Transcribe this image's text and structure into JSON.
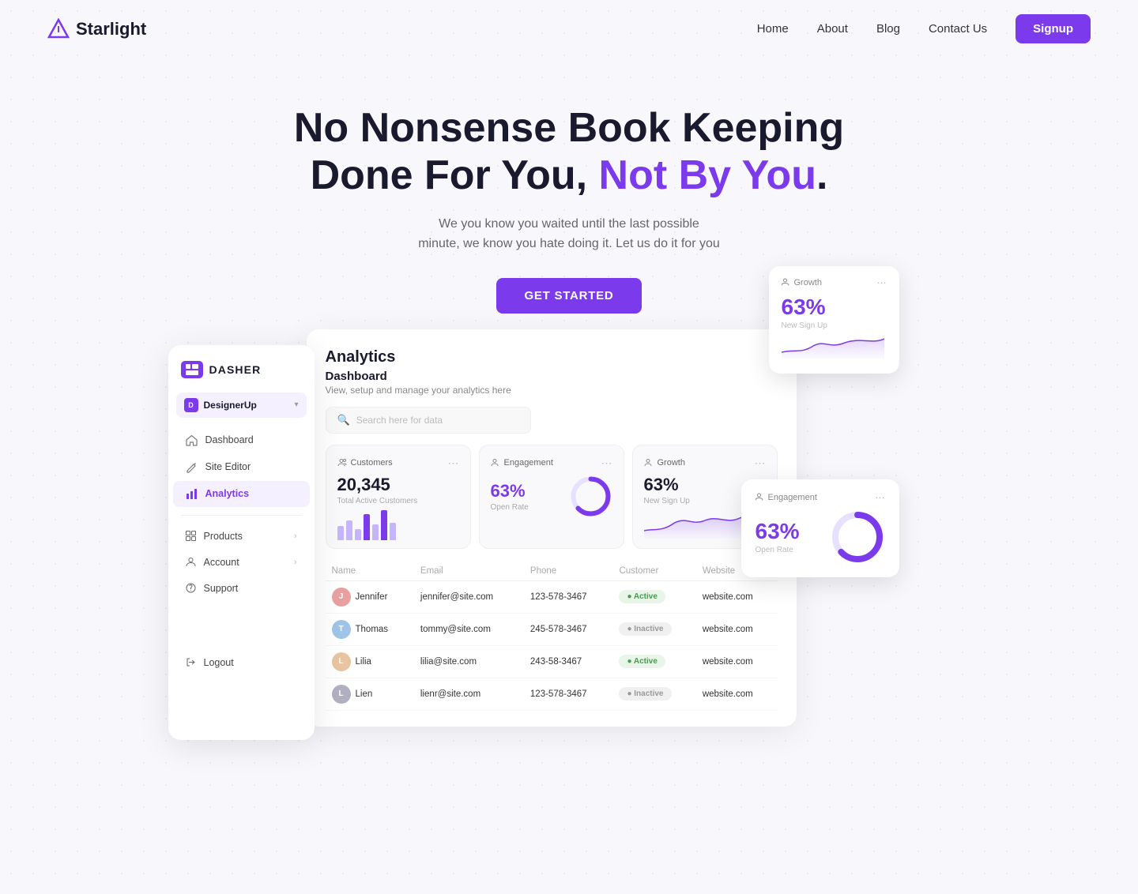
{
  "nav": {
    "logo": "Starlight",
    "links": [
      "Home",
      "About",
      "Blog",
      "Contact Us"
    ],
    "signup_label": "Signup"
  },
  "hero": {
    "line1": "No Nonsense Book Keeping",
    "line2_normal": "Done For You, ",
    "line2_accent": "Not By You",
    "line2_end": ".",
    "desc1": "We you know you waited until the last possible",
    "desc2": "minute, we know you hate doing it. Let us do it for you",
    "cta": "GET STARTED"
  },
  "sidebar": {
    "brand": "DASHER",
    "org": "DesignerUp",
    "nav": [
      {
        "label": "Dashboard",
        "icon": "home"
      },
      {
        "label": "Site Editor",
        "icon": "edit"
      },
      {
        "label": "Analytics",
        "icon": "bar-chart",
        "active": true
      }
    ],
    "groups": [
      {
        "label": "Products"
      },
      {
        "label": "Account"
      },
      {
        "label": "Support"
      }
    ],
    "logout": "Logout"
  },
  "dashboard": {
    "title": "Analytics",
    "page_title": "Dashboard",
    "subtitle": "View, setup and manage your analytics here",
    "search_placeholder": "Search here for data",
    "stats": [
      {
        "label": "Customers",
        "value": "20,345",
        "sub": "Total Active Customers",
        "type": "bar"
      },
      {
        "label": "Engagement",
        "value": "63%",
        "sub": "Open Rate",
        "type": "donut"
      },
      {
        "label": "Growth",
        "value": "63%",
        "sub": "New Sign Up",
        "type": "sparkline"
      }
    ],
    "table": {
      "headers": [
        "Name",
        "Email",
        "Phone",
        "Customer",
        "Website"
      ],
      "rows": [
        {
          "name": "Jennifer",
          "email": "jennifer@site.com",
          "phone": "123-578-3467",
          "status": "Active",
          "website": "website.com",
          "color": "#e8a0a0"
        },
        {
          "name": "Thomas",
          "email": "tommy@site.com",
          "phone": "245-578-3467",
          "status": "Inactive",
          "website": "website.com",
          "color": "#a0c4e8"
        },
        {
          "name": "Lilia",
          "email": "lilia@site.com",
          "phone": "243-58-3467",
          "status": "Active",
          "website": "website.com",
          "color": "#e8c4a0"
        },
        {
          "name": "Lien",
          "email": "lienr@site.com",
          "phone": "123-578-3467",
          "status": "Inactive",
          "website": "website.com",
          "color": "#b0b0c0"
        }
      ]
    }
  },
  "float_growth": {
    "label": "Growth",
    "value": "63%",
    "sub": "New Sign Up"
  },
  "float_engagement": {
    "label": "Engagement",
    "value": "63%",
    "sub": "Open Rate"
  },
  "colors": {
    "primary": "#7c3aed",
    "accent": "#7c3aed"
  }
}
